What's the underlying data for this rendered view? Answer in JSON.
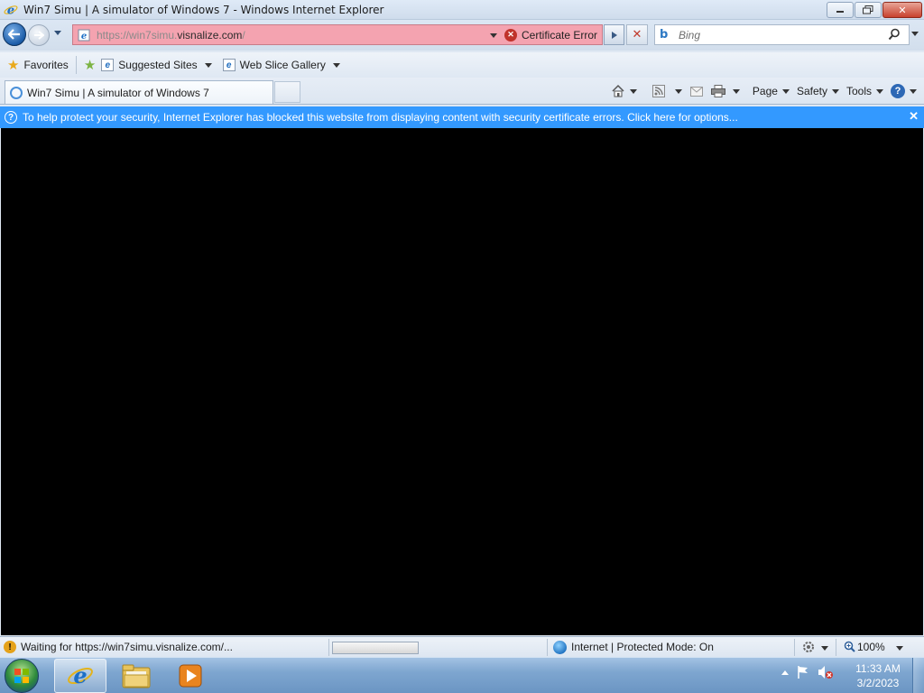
{
  "window": {
    "title": "Win7 Simu | A simulator of Windows 7 - Windows Internet Explorer"
  },
  "address_bar": {
    "url_prefix": "https://win7simu.",
    "url_domain": "visnalize.com",
    "url_suffix": "/",
    "certificate_label": "Certificate Error"
  },
  "search": {
    "placeholder": "Bing"
  },
  "favorites_bar": {
    "favorites_label": "Favorites",
    "items": [
      {
        "label": "Suggested Sites"
      },
      {
        "label": "Web Slice Gallery"
      }
    ]
  },
  "tab": {
    "title": "Win7 Simu | A simulator of Windows 7"
  },
  "command_bar": {
    "page_label": "Page",
    "safety_label": "Safety",
    "tools_label": "Tools"
  },
  "info_bar": {
    "message": "To help protect your security, Internet Explorer has blocked this website from displaying content with security certificate errors. Click here for options..."
  },
  "status_bar": {
    "status_text": "Waiting for https://win7simu.visnalize.com/...",
    "zone_text": "Internet | Protected Mode: On",
    "zoom": "100%"
  },
  "taskbar": {
    "time": "11:33 AM",
    "date": "3/2/2023"
  },
  "colors": {
    "address_error_bg": "#f4a3b0",
    "info_bar_bg": "#3399ff",
    "content_bg": "#000000"
  }
}
